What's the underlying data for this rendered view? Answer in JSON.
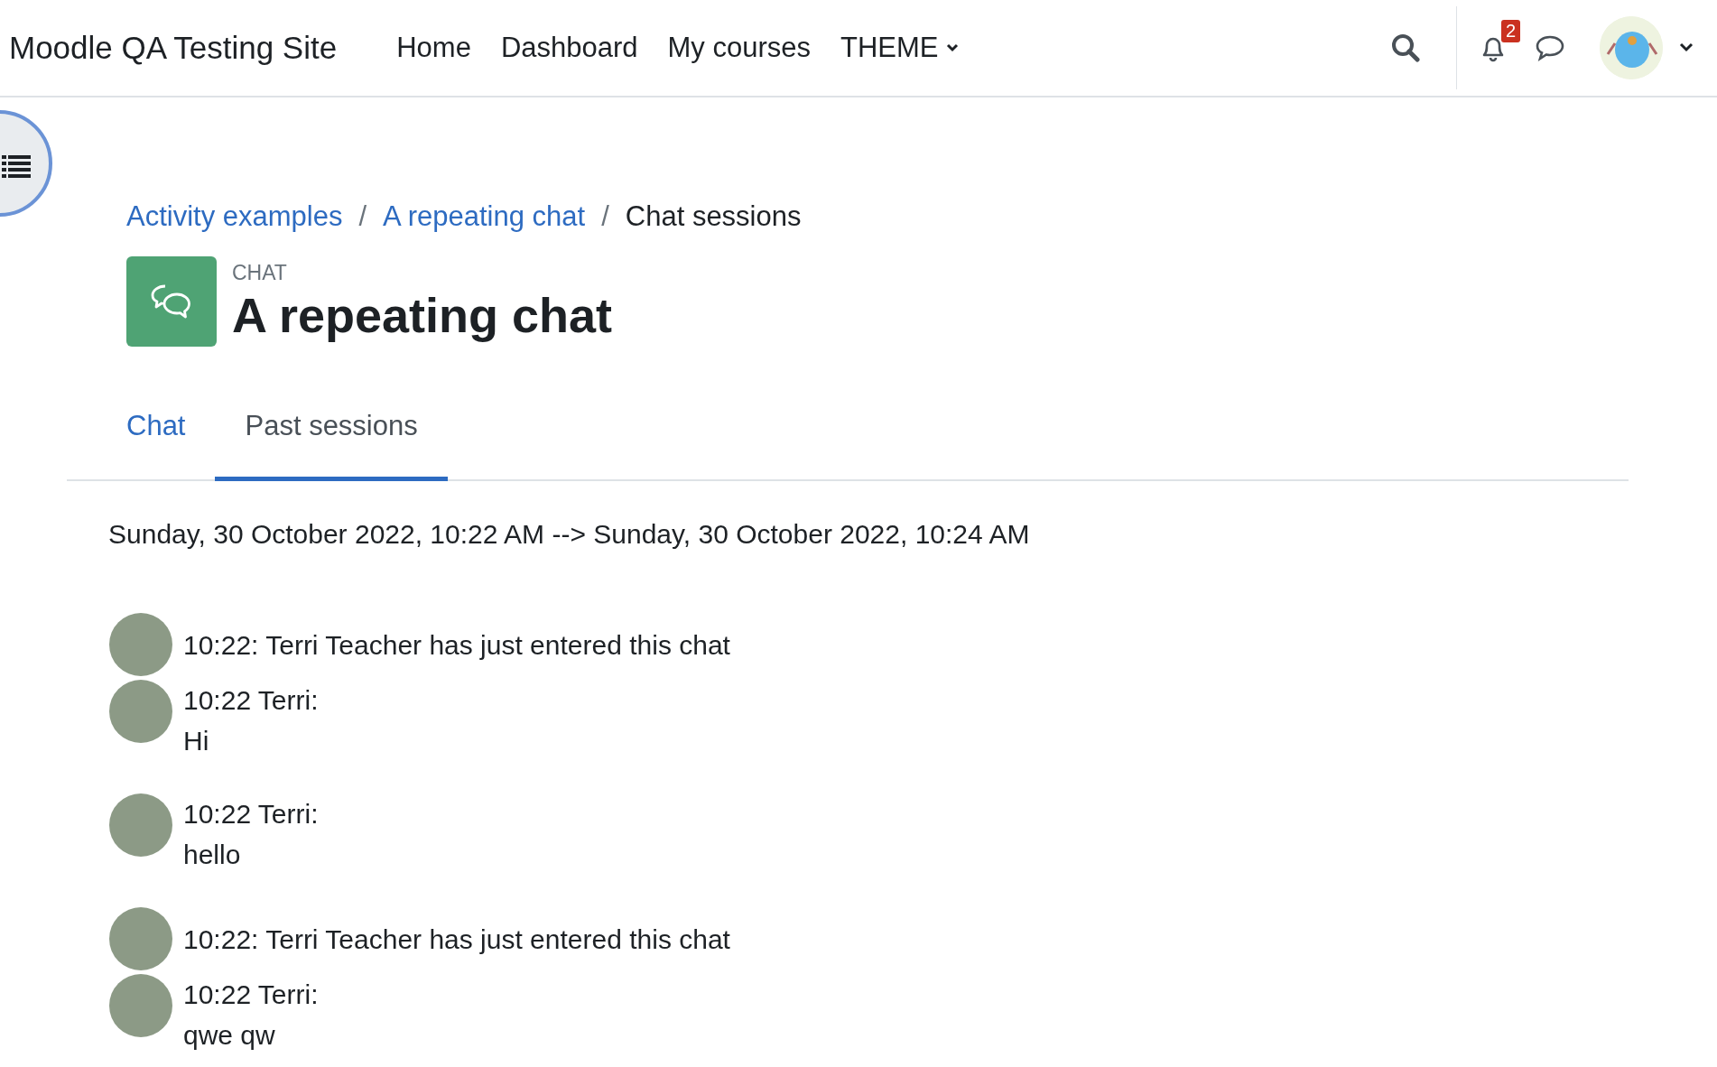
{
  "header": {
    "site_name": "Moodle QA Testing Site",
    "nav": [
      {
        "label": "Home",
        "kind": "link"
      },
      {
        "label": "Dashboard",
        "kind": "link"
      },
      {
        "label": "My courses",
        "kind": "link"
      },
      {
        "label": "THEME",
        "kind": "dropdown"
      }
    ],
    "notification_count": "2"
  },
  "breadcrumb_separator": "/",
  "breadcrumb": [
    {
      "label": "Activity examples",
      "kind": "link"
    },
    {
      "label": "A repeating chat",
      "kind": "link"
    },
    {
      "label": "Chat sessions",
      "kind": "current"
    }
  ],
  "activity": {
    "type_label": "CHAT",
    "title": "A repeating chat"
  },
  "tabs": [
    {
      "label": "Chat",
      "selected": false
    },
    {
      "label": "Past sessions",
      "selected": true
    }
  ],
  "session": {
    "range": "Sunday, 30 October 2022, 10:22 AM --> Sunday, 30 October 2022, 10:24 AM"
  },
  "messages": [
    {
      "kind": "system",
      "text": "10:22: Terri Teacher has just entered this chat"
    },
    {
      "kind": "message",
      "author_line": "10:22 Terri:",
      "text": "Hi"
    },
    {
      "kind": "message",
      "author_line": "10:22 Terri:",
      "text": "hello"
    },
    {
      "kind": "system",
      "text": "10:22: Terri Teacher has just entered this chat"
    },
    {
      "kind": "message",
      "author_line": "10:22 Terri:",
      "text": "qwe qw"
    }
  ]
}
